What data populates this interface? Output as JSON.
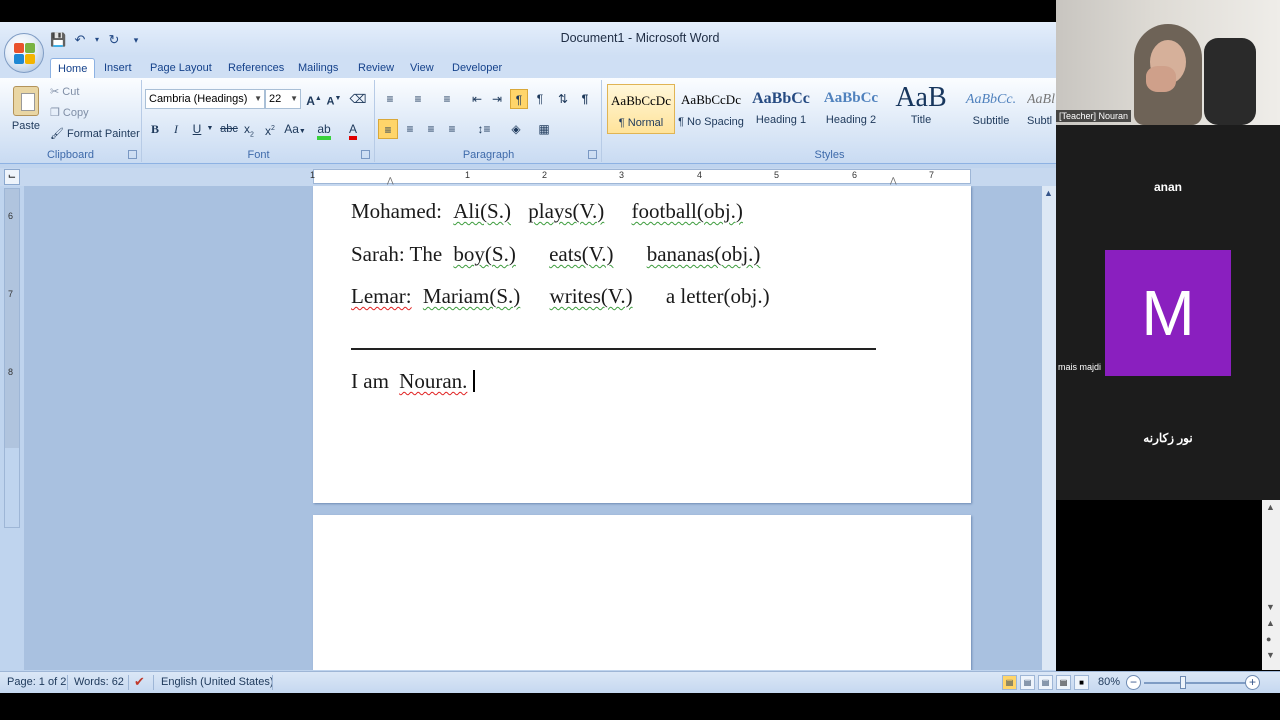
{
  "window": {
    "title": "Document1 - Microsoft Word"
  },
  "tabs": [
    "Home",
    "Insert",
    "Page Layout",
    "References",
    "Mailings",
    "Review",
    "View",
    "Developer"
  ],
  "clipboard": {
    "paste": "Paste",
    "cut": "Cut",
    "copy": "Copy",
    "format_painter": "Format Painter",
    "label": "Clipboard"
  },
  "font": {
    "name": "Cambria (Headings)",
    "size": "22",
    "label": "Font"
  },
  "paragraph": {
    "label": "Paragraph"
  },
  "styles": {
    "label": "Styles",
    "items": [
      {
        "preview": "AaBbCcDc",
        "name": "¶ Normal"
      },
      {
        "preview": "AaBbCcDc",
        "name": "¶ No Spacing"
      },
      {
        "preview": "AaBbCc",
        "name": "Heading 1"
      },
      {
        "preview": "AaBbCc",
        "name": "Heading 2"
      },
      {
        "preview": "AaB",
        "name": "Title"
      },
      {
        "preview": "AaBbCc.",
        "name": "Subtitle"
      },
      {
        "preview": "AaBl",
        "name": "Subtl"
      }
    ]
  },
  "document": {
    "lines": [
      {
        "label": "Mohamed:",
        "subject": "Ali(S.)",
        "verb": "plays(V.)",
        "object": "football(obj.)"
      },
      {
        "label": "Sarah: The",
        "subject": "boy(S.)",
        "verb": "eats(V.)",
        "object": "bananas(obj.)"
      },
      {
        "label": "Lemar:",
        "subject": "Mariam(S.)",
        "verb": "writes(V.)",
        "object": "a letter(obj.)"
      }
    ],
    "sentence_prefix": "I am",
    "sentence_name": "Nouran.",
    "ruler_numbers": [
      "1",
      "1",
      "2",
      "3",
      "4",
      "5",
      "6",
      "7"
    ],
    "vruler_numbers": [
      "6",
      "7",
      "8"
    ]
  },
  "status": {
    "page": "Page: 1 of 2",
    "words": "Words: 62",
    "language": "English (United States)",
    "zoom": "80%"
  },
  "meeting": {
    "teacher_label": "[Teacher] Nouran",
    "participants": [
      "anan",
      "mais majdi",
      "نور زكارنه"
    ],
    "avatar_letter": "M"
  },
  "colors": {
    "avatar": "#8a1fbf",
    "ribbon": "#dce8f7",
    "doc_bg": "#a9c1e0"
  }
}
